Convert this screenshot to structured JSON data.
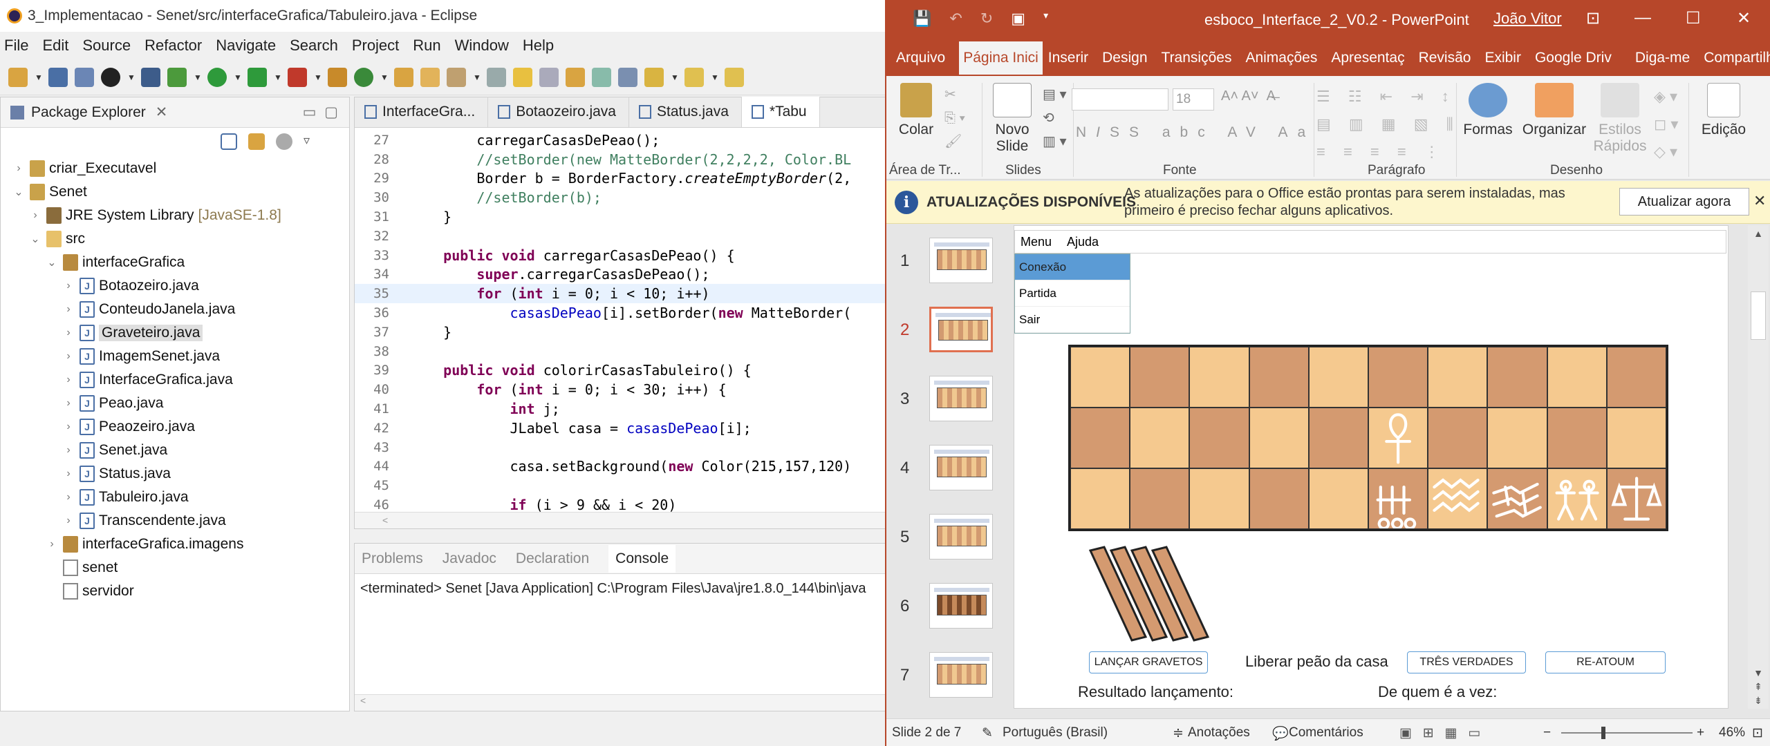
{
  "eclipse": {
    "window_title": "3_Implementacao - Senet/src/interfaceGrafica/Tabuleiro.java - Eclipse",
    "menu": [
      "File",
      "Edit",
      "Source",
      "Refactor",
      "Navigate",
      "Search",
      "Project",
      "Run",
      "Window",
      "Help"
    ],
    "package_explorer": {
      "title": "Package Explorer",
      "tree": [
        {
          "label": "criar_Executavel",
          "level": 0,
          "arrow": ">",
          "icon": "project-icon"
        },
        {
          "label": "Senet",
          "level": 0,
          "arrow": "v",
          "icon": "project-icon"
        },
        {
          "label": "JRE System Library",
          "extra": "[JavaSE-1.8]",
          "level": 1,
          "arrow": ">",
          "icon": "library-icon"
        },
        {
          "label": "src",
          "level": 1,
          "arrow": "v",
          "icon": "folder-icon"
        },
        {
          "label": "interfaceGrafica",
          "level": 2,
          "arrow": "v",
          "icon": "package-icon"
        },
        {
          "label": "Botaozeiro.java",
          "level": 3,
          "arrow": ">",
          "icon": "java-file-icon"
        },
        {
          "label": "ConteudoJanela.java",
          "level": 3,
          "arrow": ">",
          "icon": "java-file-icon"
        },
        {
          "label": "Graveteiro.java",
          "level": 3,
          "arrow": ">",
          "icon": "java-file-icon",
          "selected": true
        },
        {
          "label": "ImagemSenet.java",
          "level": 3,
          "arrow": ">",
          "icon": "java-file-icon"
        },
        {
          "label": "InterfaceGrafica.java",
          "level": 3,
          "arrow": ">",
          "icon": "java-file-icon"
        },
        {
          "label": "Peao.java",
          "level": 3,
          "arrow": ">",
          "icon": "java-file-icon"
        },
        {
          "label": "Peaozeiro.java",
          "level": 3,
          "arrow": ">",
          "icon": "java-file-icon"
        },
        {
          "label": "Senet.java",
          "level": 3,
          "arrow": ">",
          "icon": "java-file-icon"
        },
        {
          "label": "Status.java",
          "level": 3,
          "arrow": ">",
          "icon": "java-file-icon"
        },
        {
          "label": "Tabuleiro.java",
          "level": 3,
          "arrow": ">",
          "icon": "java-file-icon"
        },
        {
          "label": "Transcendente.java",
          "level": 3,
          "arrow": ">",
          "icon": "java-file-icon"
        },
        {
          "label": "interfaceGrafica.imagens",
          "level": 2,
          "arrow": ">",
          "icon": "package-icon"
        },
        {
          "label": "senet",
          "level": 2,
          "arrow": "",
          "icon": "package-empty-icon"
        },
        {
          "label": "servidor",
          "level": 2,
          "arrow": "",
          "icon": "package-empty-icon"
        }
      ]
    },
    "editor_tabs": [
      "InterfaceGra...",
      "Botaozeiro.java",
      "Status.java",
      "*Tabu"
    ],
    "code_lines": [
      {
        "n": "27",
        "t": "        carregarCasasDePeao();"
      },
      {
        "n": "28",
        "t": "        //setBorder(new MatteBorder(2,2,2,2, Color.BL"
      },
      {
        "n": "29",
        "t": "        Border b = BorderFactory.createEmptyBorder(2,"
      },
      {
        "n": "30",
        "t": "        //setBorder(b);"
      },
      {
        "n": "31",
        "t": "    }"
      },
      {
        "n": "32",
        "t": ""
      },
      {
        "n": "33",
        "t": "    public void carregarCasasDePeao() {"
      },
      {
        "n": "34",
        "t": "        super.carregarCasasDePeao();"
      },
      {
        "n": "35",
        "t": "        for (int i = 0; i < 10; i++)"
      },
      {
        "n": "36",
        "t": "            casasDePeao[i].setBorder(new MatteBorder("
      },
      {
        "n": "37",
        "t": "    }"
      },
      {
        "n": "38",
        "t": ""
      },
      {
        "n": "39",
        "t": "    public void colorirCasasTabuleiro() {"
      },
      {
        "n": "40",
        "t": "        for (int i = 0; i < 30; i++) {"
      },
      {
        "n": "41",
        "t": "            int j;"
      },
      {
        "n": "42",
        "t": "            JLabel casa = casasDePeao[i];"
      },
      {
        "n": "43",
        "t": ""
      },
      {
        "n": "44",
        "t": "            casa.setBackground(new Color(215,157,120)"
      },
      {
        "n": "45",
        "t": ""
      },
      {
        "n": "46",
        "t": "            if (i > 9 && i < 20)"
      }
    ],
    "bottom_tabs": [
      "Problems",
      "Javadoc",
      "Declaration",
      "Console"
    ],
    "console_text": "<terminated> Senet [Java Application] C:\\Program Files\\Java\\jre1.8.0_144\\bin\\java"
  },
  "powerpoint": {
    "file_title": "esboco_Interface_2_V0.2  -  PowerPoint",
    "user": "João Vitor",
    "tabs": [
      "Arquivo",
      "Página Inici",
      "Inserir",
      "Design",
      "Transições",
      "Animações",
      "Apresentaç",
      "Revisão",
      "Exibir",
      "Google Driv",
      "Diga-me",
      "Compartilhar"
    ],
    "ribbon": {
      "colar": "Colar",
      "novo_slide": "Novo Slide",
      "font_size": "18",
      "formas": "Formas",
      "organizar": "Organizar",
      "estilos": "Estilos Rápidos",
      "edicao": "Edição",
      "groups": [
        "Área de Tr...",
        "Slides",
        "Fonte",
        "Parágrafo",
        "Desenho"
      ]
    },
    "update_bar": {
      "title": "ATUALIZAÇÕES DISPONÍVEIS",
      "message": "As atualizações para o Office estão prontas para serem instaladas, mas primeiro é preciso fechar alguns aplicativos.",
      "button": "Atualizar agora"
    },
    "thumbnails": [
      "1",
      "2",
      "3",
      "4",
      "5",
      "6",
      "7"
    ],
    "current_slide": 2,
    "slide": {
      "menubar": [
        "Menu",
        "Ajuda"
      ],
      "dropdown": [
        "Conexão",
        "Partida",
        "Sair"
      ],
      "buttons": [
        "LANÇAR GRAVETOS",
        "TRÊS VERDADES",
        "RE-ATOUM"
      ],
      "liberar_label": "Liberar peão da casa",
      "resultado_label": "Resultado lançamento:",
      "vez_label": "De quem é a vez:"
    },
    "status": {
      "slide_info": "Slide 2 de 7",
      "language": "Português (Brasil)",
      "notes": "Anotações",
      "comments": "Comentários",
      "zoom": "46%"
    }
  }
}
